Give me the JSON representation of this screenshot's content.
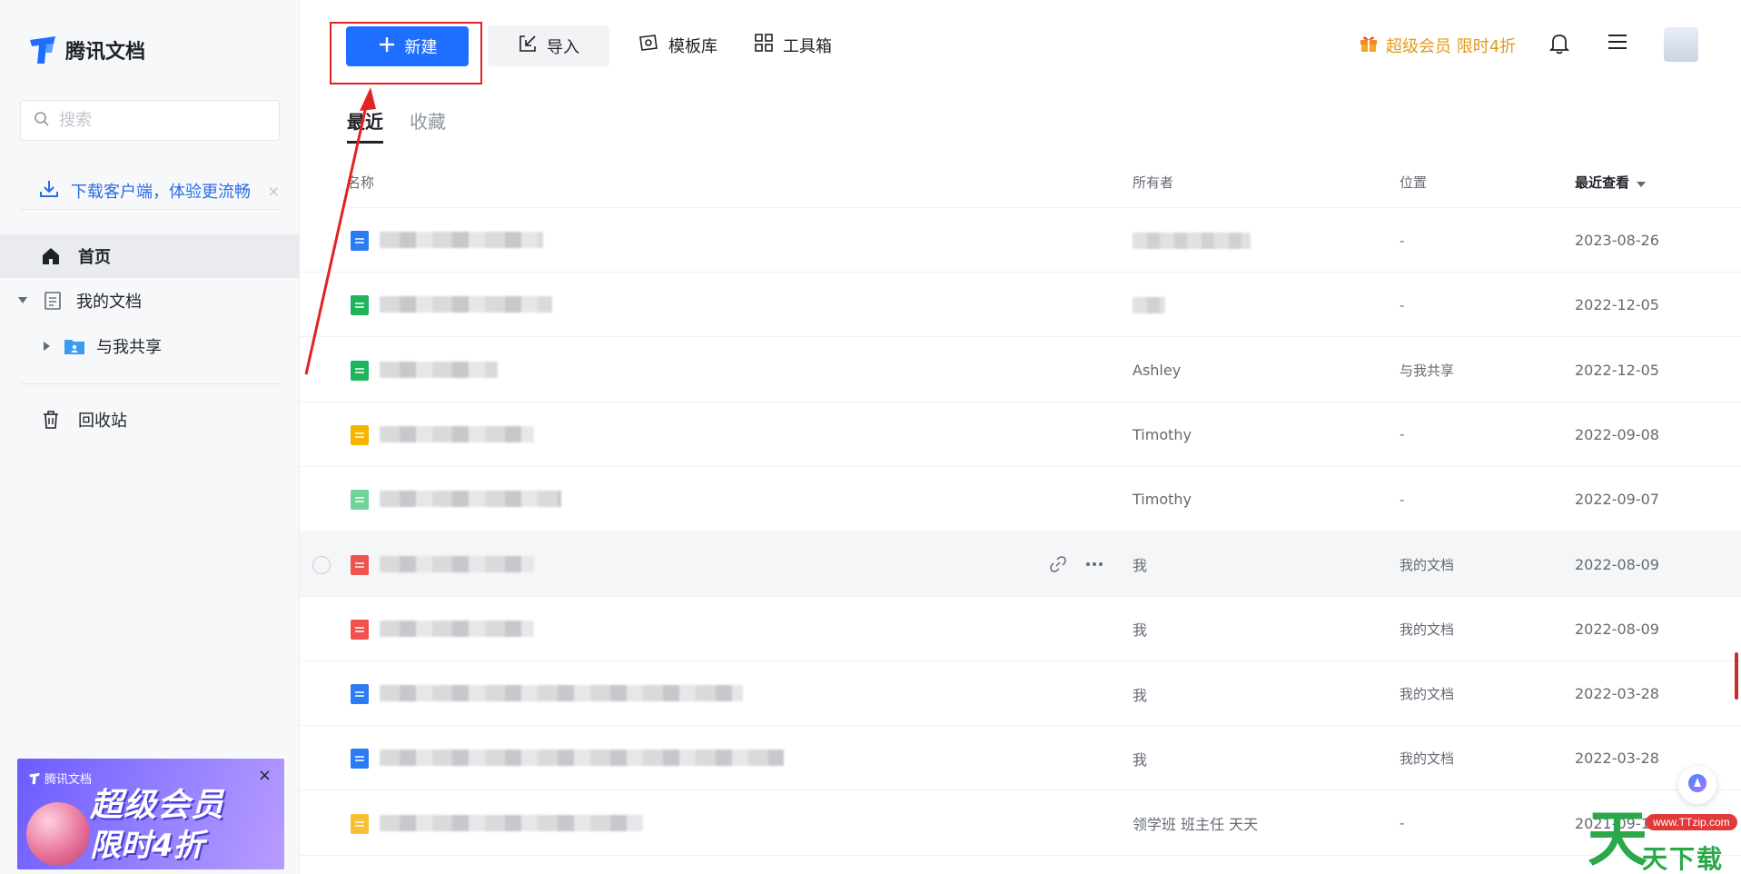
{
  "app": {
    "name": "腾讯文档"
  },
  "sidebar": {
    "search_placeholder": "搜索",
    "download_text": "下载客户端，体验更流畅",
    "download_close": "×",
    "nav": [
      {
        "label": "首页",
        "icon": "home-icon"
      },
      {
        "label": "我的文档",
        "icon": "document-icon"
      },
      {
        "label": "与我共享",
        "icon": "shared-folder-icon"
      },
      {
        "label": "回收站",
        "icon": "trash-icon"
      }
    ],
    "promo": {
      "logo": "腾讯文档",
      "line1": "超级会员",
      "line2": "限时4折",
      "close": "×"
    }
  },
  "toolbar": {
    "new_label": "新建",
    "import_label": "导入",
    "templates_label": "模板库",
    "toolbox_label": "工具箱",
    "vip_label": "超级会员 限时4折"
  },
  "tabs": [
    {
      "label": "最近",
      "active": true
    },
    {
      "label": "收藏",
      "active": false
    }
  ],
  "table": {
    "headers": {
      "name": "名称",
      "owner": "所有者",
      "location": "位置",
      "sort": "最近查看"
    },
    "rows": [
      {
        "type": "doc",
        "owner": "",
        "location": "-",
        "date": "2023-08-26"
      },
      {
        "type": "sheet",
        "owner": "",
        "location": "-",
        "date": "2022-12-05"
      },
      {
        "type": "sheet",
        "owner": "Ashley",
        "location": "与我共享",
        "date": "2022-12-05"
      },
      {
        "type": "form",
        "owner": "Timothy",
        "location": "-",
        "date": "2022-09-08"
      },
      {
        "type": "sheet-light",
        "owner": "Timothy",
        "location": "-",
        "date": "2022-09-07"
      },
      {
        "type": "pdf",
        "owner": "我",
        "location": "我的文档",
        "date": "2022-08-09",
        "hover": true
      },
      {
        "type": "pdf",
        "owner": "我",
        "location": "我的文档",
        "date": "2022-08-09"
      },
      {
        "type": "doc",
        "owner": "我",
        "location": "我的文档",
        "date": "2022-03-28"
      },
      {
        "type": "doc",
        "owner": "我",
        "location": "我的文档",
        "date": "2022-03-28"
      },
      {
        "type": "folder",
        "owner": "领学班 班主任 天天",
        "location": "-",
        "date": "2021-09-16"
      }
    ]
  },
  "watermark": {
    "url": "www.TTzip.com",
    "text": "天下载",
    "big": "天"
  },
  "colors": {
    "accent": "#1e6fff",
    "vip": "#e29a1c",
    "highlight": "#e32222"
  }
}
